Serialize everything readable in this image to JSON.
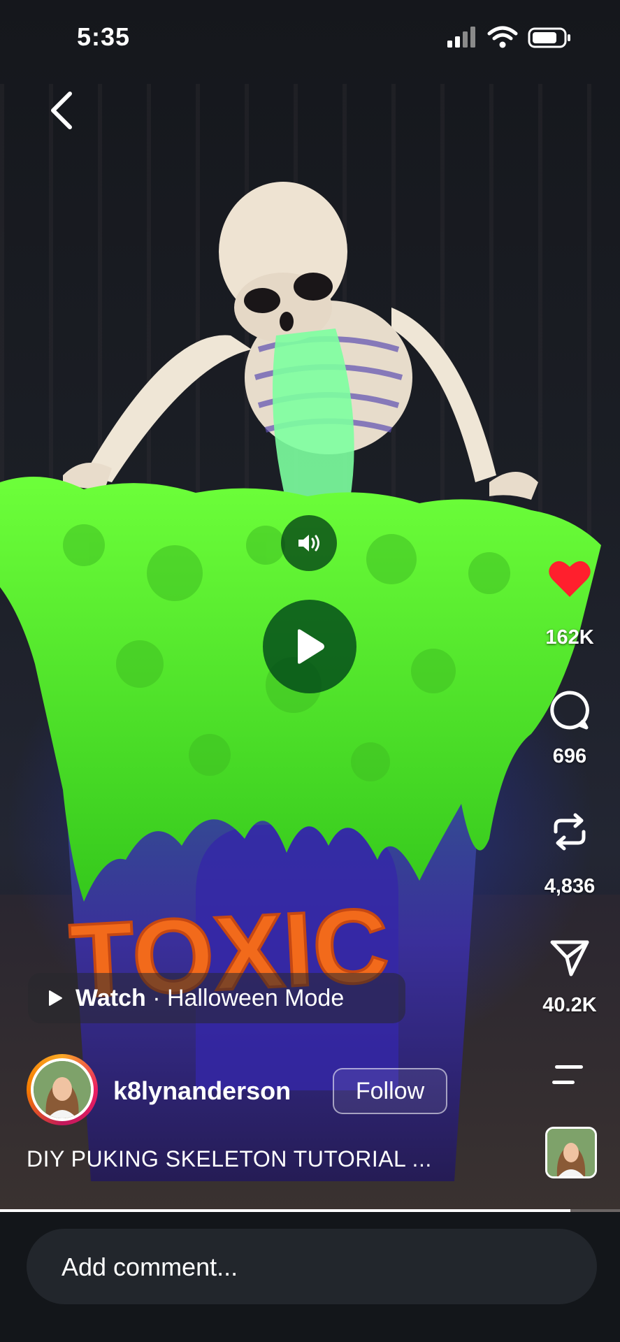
{
  "status_bar": {
    "time": "5:35"
  },
  "video": {
    "sign_text": "TOXIC",
    "progress_fraction": 0.92
  },
  "actions": {
    "likes": "162K",
    "comments": "696",
    "reposts": "4,836",
    "shares": "40.2K"
  },
  "watch_chip": {
    "label": "Watch",
    "separator": " · ",
    "title": "Halloween Mode"
  },
  "author": {
    "username": "k8lynanderson",
    "follow_label": "Follow"
  },
  "caption": "DIY PUKING SKELETON TUTORIAL ...",
  "comment": {
    "placeholder": "Add comment..."
  },
  "colors": {
    "like": "#ff1f2d",
    "slime": "#5df52a",
    "background": "#13161a"
  },
  "icons": [
    "back-icon",
    "volume-icon",
    "play-icon",
    "heart-icon",
    "comment-icon",
    "repost-icon",
    "share-icon",
    "menu-icon"
  ]
}
